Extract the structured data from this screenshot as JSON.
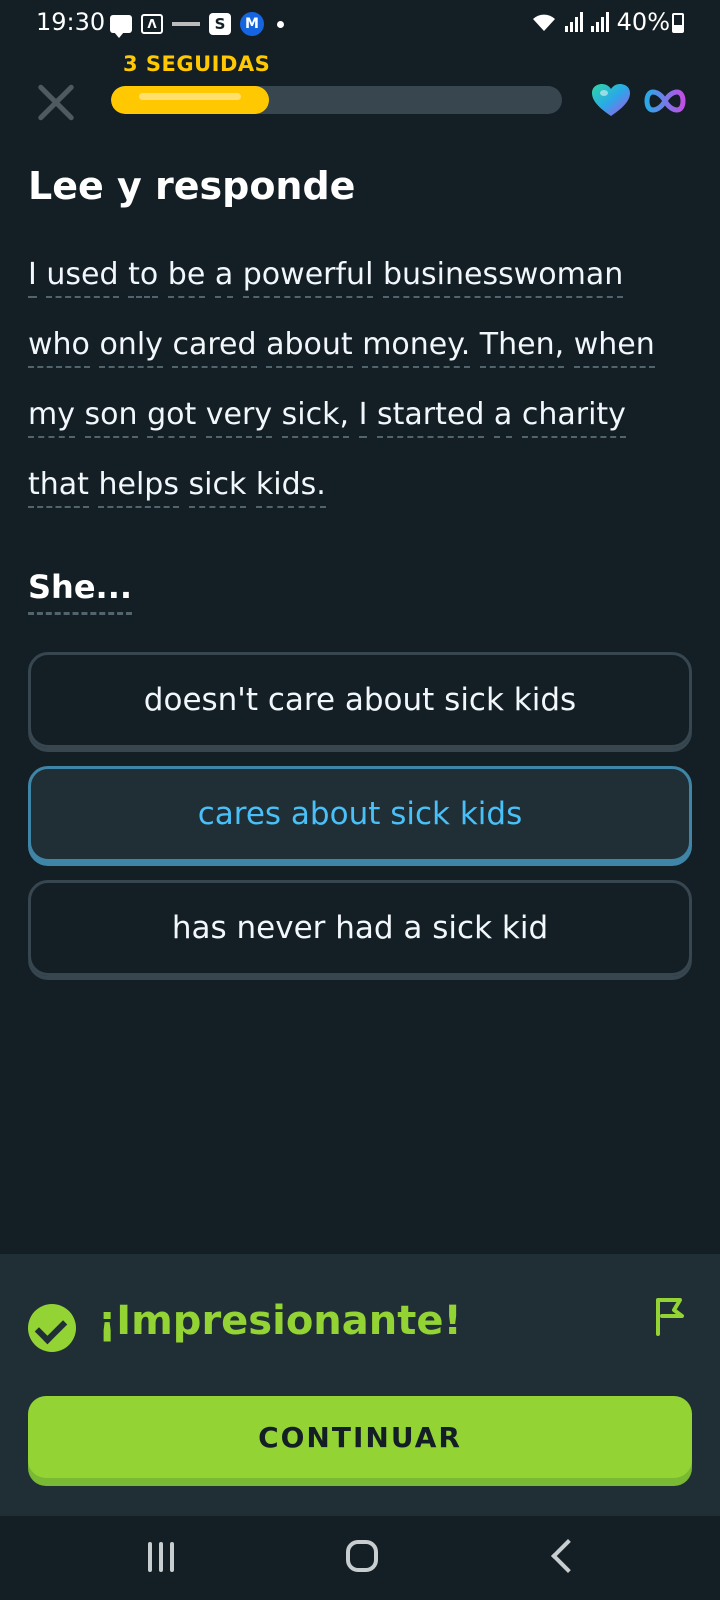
{
  "status_bar": {
    "time": "19:30",
    "battery": "40%",
    "sb_s": "S",
    "sb_m": "M",
    "sb_a": "Λ"
  },
  "header": {
    "streak": "3 SEGUIDAS",
    "progress": 0.35,
    "hearts": "infinite"
  },
  "exercise": {
    "title": "Lee y responde",
    "passage_words": [
      "I",
      "used",
      "to",
      "be",
      "a",
      "powerful",
      "businesswoman",
      "who",
      "only",
      "cared",
      "about",
      "money.",
      "Then,",
      "when",
      "my",
      "son",
      "got",
      "very",
      "sick,",
      "I",
      "started",
      "a",
      "charity",
      "that",
      "helps",
      "sick",
      "kids."
    ],
    "question": "She...",
    "options": [
      {
        "label": "doesn't care about sick kids",
        "selected": false
      },
      {
        "label": "cares about sick kids",
        "selected": true
      },
      {
        "label": "has never had a sick kid",
        "selected": false
      }
    ]
  },
  "feedback": {
    "message": "¡Impresionante!",
    "continue_label": "CONTINUAR"
  },
  "colors": {
    "background": "#141f25",
    "accent_green": "#93d333",
    "accent_blue": "#49c0f8",
    "streak_yellow": "#ffc800"
  }
}
